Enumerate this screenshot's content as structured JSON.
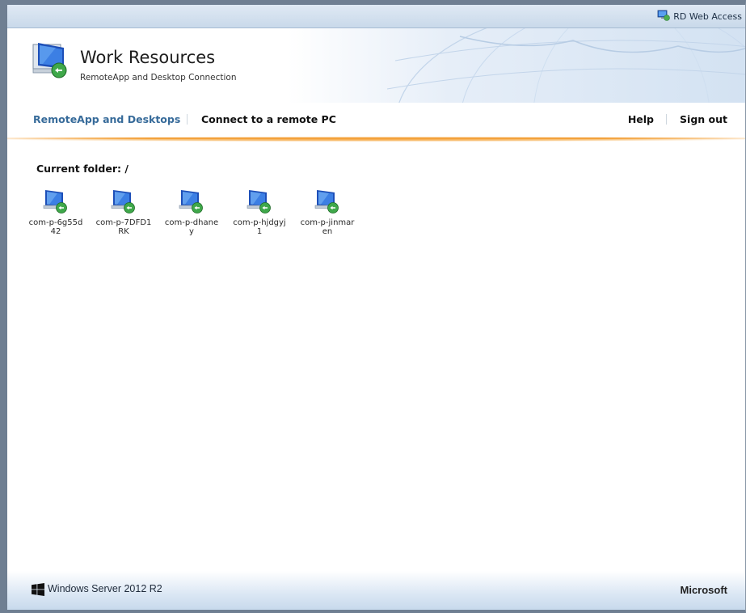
{
  "topbar": {
    "label": "RD Web Access",
    "icon": "rd-web-access-icon"
  },
  "header": {
    "title": "Work Resources",
    "subtitle": "RemoteApp and Desktop Connection",
    "logo_icon": "remote-desktop-logo-icon"
  },
  "nav": {
    "tabs": [
      {
        "label": "RemoteApp and Desktops",
        "active": true
      },
      {
        "label": "Connect to a remote PC",
        "active": false
      }
    ],
    "help_label": "Help",
    "signout_label": "Sign out"
  },
  "colors": {
    "active_tab": "#376b9a",
    "tab": "#111111",
    "accent_line": "#f3a13b"
  },
  "content": {
    "folder_label": "Current folder: /",
    "resources": [
      {
        "name": "com-p-6g55d42",
        "icon": "remote-desktop-icon"
      },
      {
        "name": "com-p-7DFD1RK",
        "icon": "remote-desktop-icon"
      },
      {
        "name": "com-p-dhaney",
        "icon": "remote-desktop-icon"
      },
      {
        "name": "com-p-hjdgyj1",
        "icon": "remote-desktop-icon"
      },
      {
        "name": "com-p-jinmaren",
        "icon": "remote-desktop-icon"
      }
    ]
  },
  "footer": {
    "product": "Windows Server 2012 R2",
    "brand": "Microsoft",
    "windows_icon": "windows-logo-icon"
  }
}
